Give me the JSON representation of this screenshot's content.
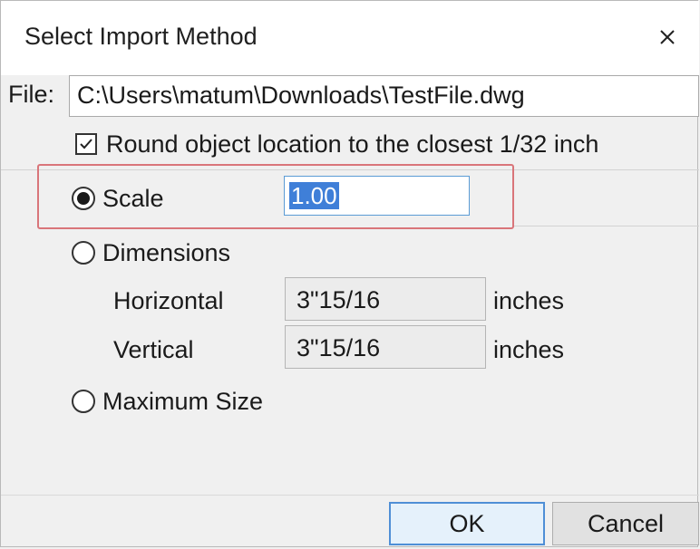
{
  "dialog": {
    "title": "Select Import Method",
    "close_icon": "close-icon"
  },
  "file": {
    "label": "File:",
    "path": "C:\\Users\\matum\\Downloads\\TestFile.dwg"
  },
  "options": {
    "round_label": "Round object location to the closest 1/32 inch",
    "round_checked": true
  },
  "methods": {
    "selected": "Scale",
    "scale_label": "Scale",
    "scale_value": "1.00",
    "dimensions_label": "Dimensions",
    "horizontal_label": "Horizontal",
    "horizontal_value": "3\"15/16",
    "horizontal_unit": "inches",
    "vertical_label": "Vertical",
    "vertical_value": "3\"15/16",
    "vertical_unit": "inches",
    "maxsize_label": "Maximum Size"
  },
  "buttons": {
    "ok": "OK",
    "cancel": "Cancel"
  },
  "colors": {
    "highlight": "#d9757a",
    "selection": "#3f7fd8",
    "ok_border": "#4f8fd6"
  }
}
